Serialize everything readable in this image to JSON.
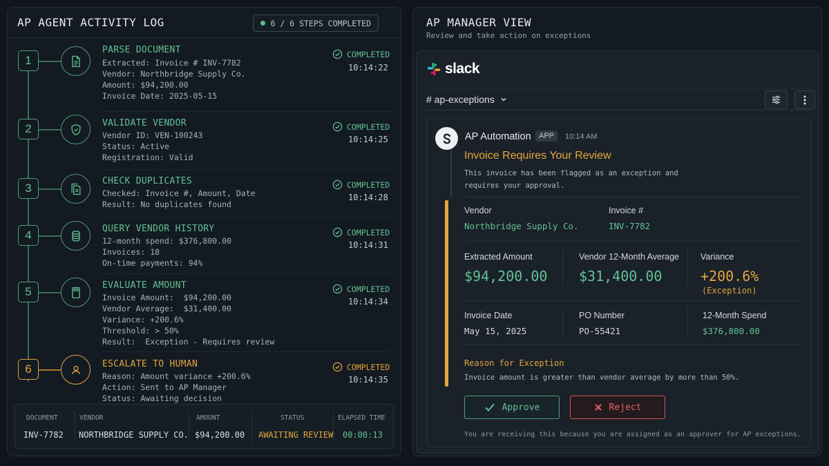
{
  "left": {
    "title": "AP AGENT ACTIVITY LOG",
    "progress": "6 / 6 STEPS COMPLETED",
    "steps": [
      {
        "num": "1",
        "title": "PARSE DOCUMENT",
        "lines": [
          "Extracted: Invoice # INV-7782",
          "Vendor: Northbridge Supply Co.",
          "Amount: $94,200.00",
          "Invoice Date: 2025-05-15"
        ],
        "status": "COMPLETED",
        "time": "10:14:22",
        "icon": "document-icon"
      },
      {
        "num": "2",
        "title": "VALIDATE VENDOR",
        "lines": [
          "Vendor ID: VEN-100243",
          "Status: Active",
          "Registration: Valid"
        ],
        "status": "COMPLETED",
        "time": "10:14:25",
        "icon": "shield-check-icon"
      },
      {
        "num": "3",
        "title": "CHECK DUPLICATES",
        "lines": [
          "Checked: Invoice #, Amount, Date",
          "Result: No duplicates found"
        ],
        "status": "COMPLETED",
        "time": "10:14:28",
        "icon": "copy-document-icon"
      },
      {
        "num": "4",
        "title": "QUERY VENDOR HISTORY",
        "lines": [
          "12-month spend: $376,800.00",
          "Invoices: 18",
          "On-time payments: 94%"
        ],
        "status": "COMPLETED",
        "time": "10:14:31",
        "icon": "database-icon"
      },
      {
        "num": "5",
        "title": "EVALUATE AMOUNT",
        "lines": [
          "Invoice Amount:  $94,200.00",
          "Vendor Average:  $31,400.00",
          "Variance: +200.6%",
          "Threshold: > 50%",
          "Result:  Exception - Requires review"
        ],
        "status": "COMPLETED",
        "time": "10:14:34",
        "icon": "calculator-icon"
      },
      {
        "num": "6",
        "title": "ESCALATE TO HUMAN",
        "lines": [
          "Reason: Amount variance +200.6%",
          "Action: Sent to AP Manager",
          "Status: Awaiting decision"
        ],
        "status": "COMPLETED",
        "time": "10:14:35",
        "icon": "user-icon"
      }
    ],
    "summary": {
      "document_h": "DOCUMENT",
      "document_v": "INV-7782",
      "vendor_h": "VENDOR",
      "vendor_v": "NORTHBRIDGE SUPPLY CO.",
      "amount_h": "AMOUNT",
      "amount_v": "$94,200.00",
      "status_h": "STATUS",
      "status_v": "AWAITING REVIEW",
      "elapsed_h": "ELAPSED TIME",
      "elapsed_v": "00:00:13"
    }
  },
  "right": {
    "title": "AP MANAGER VIEW",
    "subtitle": "Review and take action on exceptions",
    "slack": {
      "wordmark": "slack",
      "channel": "# ap-exceptions",
      "bot_name": "AP Automation",
      "app_badge": "APP",
      "time": "10:14 AM",
      "heading": "Invoice Requires Your Review",
      "intro_1": "This invoice has been flagged as an exception and",
      "intro_2": "requires your approval.",
      "vendor_label": "Vendor",
      "vendor_value": "Northbridge Supply Co.",
      "invoice_label": "Invoice #",
      "invoice_value": "INV-7782",
      "extracted_label": "Extracted Amount",
      "extracted_value": "$94,200.00",
      "average_label": "Vendor 12-Month Average",
      "average_value": "$31,400.00",
      "variance_label": "Variance",
      "variance_value": "+200.6%",
      "variance_note": "(Exception)",
      "date_label": "Invoice Date",
      "date_value": "May 15, 2025",
      "po_label": "PO Number",
      "po_value": "PO-55421",
      "spend_label": "12-Month Spend",
      "spend_value": "$376,800.00",
      "reason_label": "Reason for Exception",
      "reason_text": "Invoice amount is greater than vendor average by more than 50%.",
      "approve": "Approve",
      "reject": "Reject",
      "footer": "You are receiving this because you are assigned as an approver for AP exceptions."
    }
  },
  "colors": {
    "green": "#64c195",
    "orange": "#e2a63c",
    "red": "#e26265",
    "background": "#0f151b"
  }
}
